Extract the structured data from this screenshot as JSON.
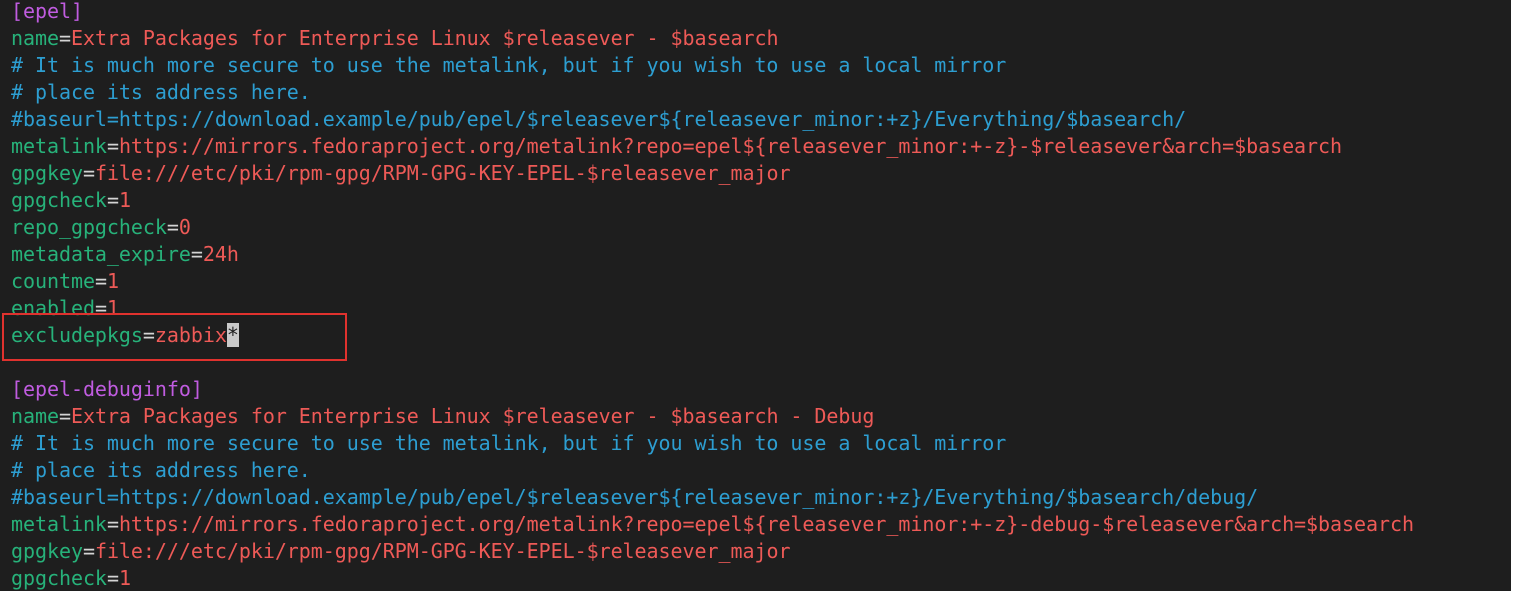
{
  "colors": {
    "background": "#1e1e1e",
    "section": "#c05ce0",
    "key": "#27b27a",
    "value": "#ee5a57",
    "comment": "#2d9ed1",
    "highlight_box": "#e0322e"
  },
  "block1": {
    "section": "[epel]",
    "name_key": "name",
    "name_val": "Extra Packages for Enterprise Linux $releasever - $basearch",
    "comment1": "# It is much more secure to use the metalink, but if you wish to use a local mirror",
    "comment2": "# place its address here.",
    "baseurl_comment": "#baseurl=https://download.example/pub/epel/$releasever${releasever_minor:+z}/Everything/$basearch/",
    "metalink_key": "metalink",
    "metalink_val": "https://mirrors.fedoraproject.org/metalink?repo=epel${releasever_minor:+-z}-$releasever&arch=$basearch",
    "gpgkey_key": "gpgkey",
    "gpgkey_val": "file:///etc/pki/rpm-gpg/RPM-GPG-KEY-EPEL-$releasever_major",
    "gpgcheck_key": "gpgcheck",
    "gpgcheck_val": "1",
    "repo_gpgcheck_key": "repo_gpgcheck",
    "repo_gpgcheck_val": "0",
    "metadata_expire_key": "metadata_expire",
    "metadata_expire_val": "24h",
    "countme_key": "countme",
    "countme_val": "1",
    "enabled_key": "enabled",
    "enabled_val": "1",
    "excludepkgs_key": "excludepkgs",
    "excludepkgs_val": "zabbix",
    "cursor_char": "*"
  },
  "block2": {
    "section": "[epel-debuginfo]",
    "name_key": "name",
    "name_val": "Extra Packages for Enterprise Linux $releasever - $basearch - Debug",
    "comment1": "# It is much more secure to use the metalink, but if you wish to use a local mirror",
    "comment2": "# place its address here.",
    "baseurl_comment": "#baseurl=https://download.example/pub/epel/$releasever${releasever_minor:+z}/Everything/$basearch/debug/",
    "metalink_key": "metalink",
    "metalink_val": "https://mirrors.fedoraproject.org/metalink?repo=epel${releasever_minor:+-z}-debug-$releasever&arch=$basearch",
    "gpgkey_key": "gpgkey",
    "gpgkey_val": "file:///etc/pki/rpm-gpg/RPM-GPG-KEY-EPEL-$releasever_major",
    "gpgcheck_key": "gpgcheck",
    "gpgcheck_val": "1"
  },
  "eq": "="
}
